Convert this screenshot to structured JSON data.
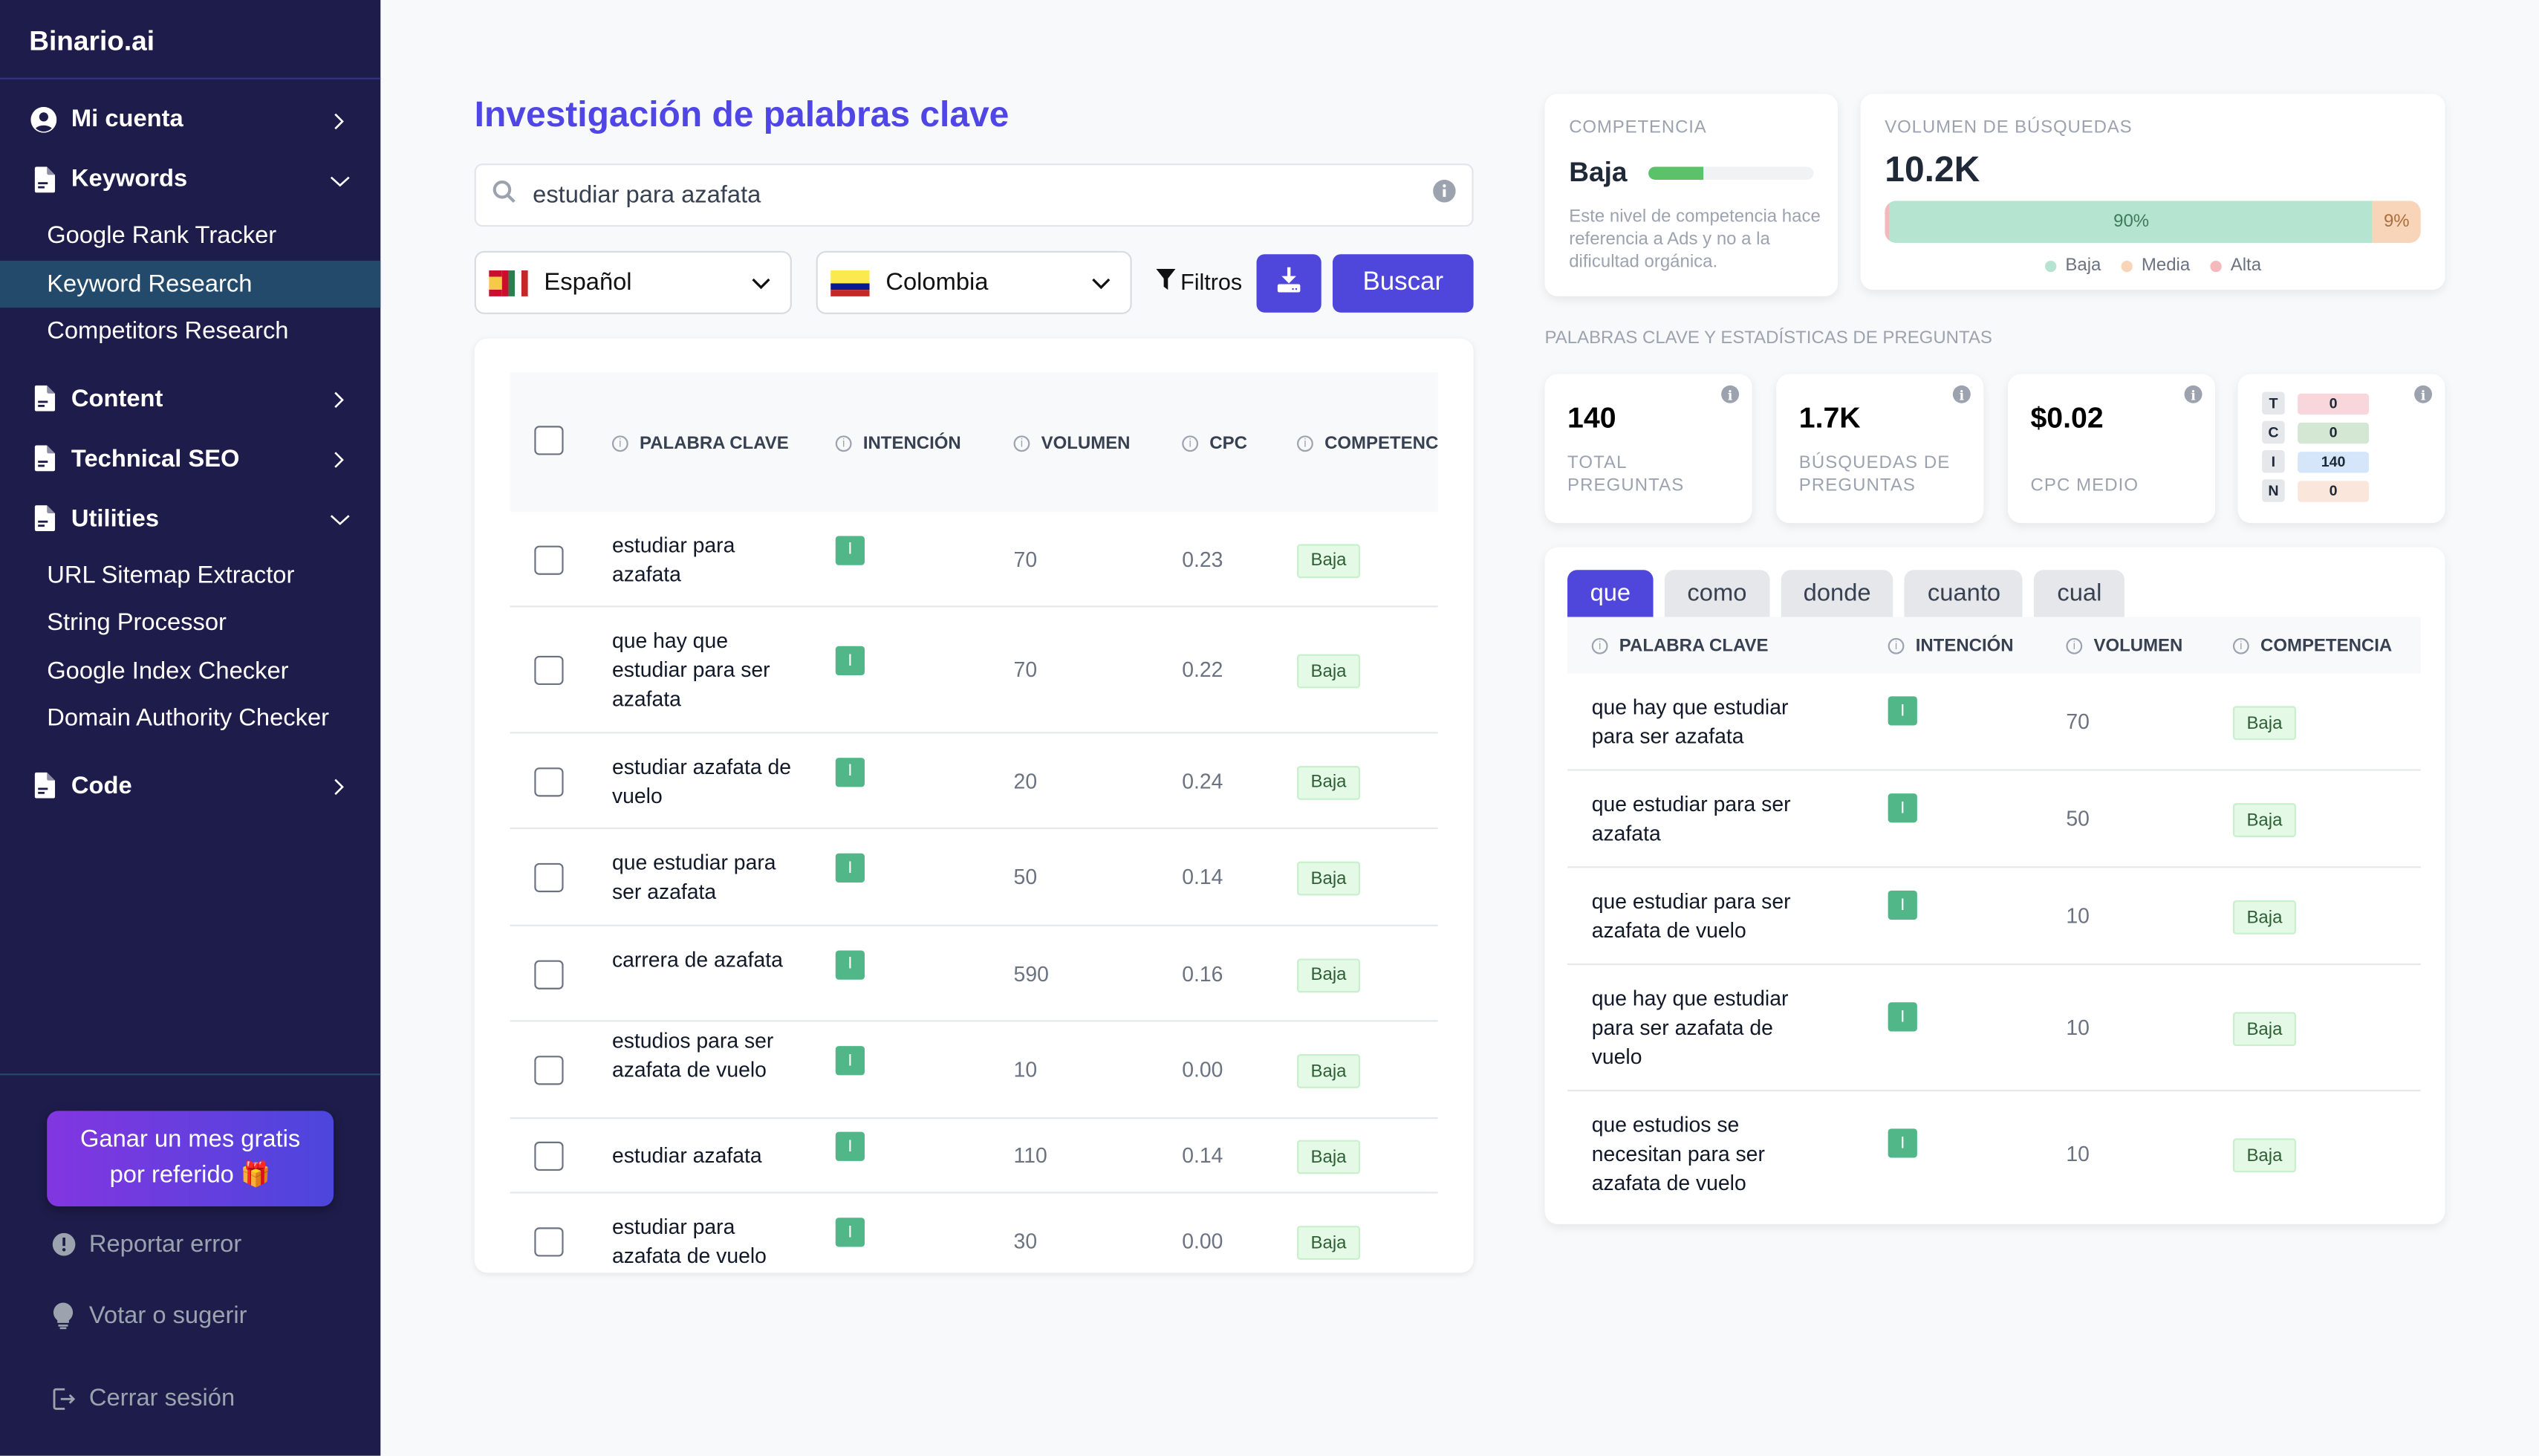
{
  "app": {
    "brand": "Binario.ai"
  },
  "sidebar": {
    "sections": [
      {
        "label": "Mi cuenta",
        "icon": "user-circle-icon",
        "expanded": false,
        "items": []
      },
      {
        "label": "Keywords",
        "icon": "document-icon",
        "expanded": true,
        "items": [
          {
            "label": "Google Rank Tracker",
            "active": false
          },
          {
            "label": "Keyword Research",
            "active": true
          },
          {
            "label": "Competitors Research",
            "active": false
          }
        ]
      },
      {
        "label": "Content",
        "icon": "document-icon",
        "expanded": false,
        "items": []
      },
      {
        "label": "Technical SEO",
        "icon": "document-icon",
        "expanded": false,
        "items": []
      },
      {
        "label": "Utilities",
        "icon": "document-icon",
        "expanded": true,
        "items": [
          {
            "label": "URL Sitemap Extractor"
          },
          {
            "label": "String Processor"
          },
          {
            "label": "Google Index Checker"
          },
          {
            "label": "Domain Authority Checker"
          }
        ]
      },
      {
        "label": "Code",
        "icon": "document-icon",
        "expanded": false,
        "items": []
      }
    ],
    "promo": {
      "line1": "Ganar un mes gratis",
      "line2": "por referido 🎁"
    },
    "links": {
      "report": "Reportar error",
      "vote": "Votar o sugerir",
      "logout": "Cerrar sesión"
    }
  },
  "main": {
    "title": "Investigación de palabras clave",
    "search": {
      "value": "estudiar para azafata",
      "placeholder": ""
    },
    "language": {
      "selected": "Español"
    },
    "country": {
      "selected": "Colombia"
    },
    "filters_label": "Filtros",
    "search_button": "Buscar",
    "table": {
      "columns": [
        "PALABRA CLAVE",
        "INTENCIÓN",
        "VOLUMEN",
        "CPC",
        "COMPETENC"
      ],
      "rows": [
        {
          "keyword": "estudiar para azafata",
          "intent": "I",
          "volume": "70",
          "cpc": "0.23",
          "competition": "Baja"
        },
        {
          "keyword": "que hay que estudiar para ser azafata",
          "intent": "I",
          "volume": "70",
          "cpc": "0.22",
          "competition": "Baja"
        },
        {
          "keyword": "estudiar azafata de vuelo",
          "intent": "I",
          "volume": "20",
          "cpc": "0.24",
          "competition": "Baja"
        },
        {
          "keyword": "que estudiar para ser azafata",
          "intent": "I",
          "volume": "50",
          "cpc": "0.14",
          "competition": "Baja"
        },
        {
          "keyword": "carrera de azafata",
          "intent": "I",
          "volume": "590",
          "cpc": "0.16",
          "competition": "Baja"
        },
        {
          "keyword": "estudios para ser azafata de vuelo",
          "intent": "I",
          "volume": "10",
          "cpc": "0.00",
          "competition": "Baja"
        },
        {
          "keyword": "estudiar azafata",
          "intent": "I",
          "volume": "110",
          "cpc": "0.14",
          "competition": "Baja"
        },
        {
          "keyword": "estudiar para azafata de vuelo",
          "intent": "I",
          "volume": "30",
          "cpc": "0.00",
          "competition": "Baja"
        }
      ]
    }
  },
  "right": {
    "competition": {
      "caption": "COMPETENCIA",
      "value": "Baja",
      "level_percent": 33,
      "description": "Este nivel de competencia hace referencia a Ads y no a la dificultad orgánica."
    },
    "volume": {
      "caption": "VOLUMEN DE BÚSQUEDAS",
      "value": "10.2K",
      "distribution": [
        {
          "name": "Alta",
          "percent": 1,
          "label": "",
          "color": "#f4b9bc"
        },
        {
          "name": "Baja",
          "percent": 90,
          "label": "90%",
          "color": "#b5e4d0"
        },
        {
          "name": "Media",
          "percent": 9,
          "label": "9%",
          "color": "#f8d4b8"
        }
      ],
      "legend": [
        {
          "name": "Baja",
          "color": "#b5e4d0"
        },
        {
          "name": "Media",
          "color": "#f8d4b8"
        },
        {
          "name": "Alta",
          "color": "#f4b9bc"
        }
      ]
    },
    "stats_caption": "PALABRAS CLAVE Y ESTADÍSTICAS DE PREGUNTAS",
    "stats": [
      {
        "value": "140",
        "label": "TOTAL PREGUNTAS"
      },
      {
        "value": "1.7K",
        "label": "BÚSQUEDAS DE PREGUNTAS"
      },
      {
        "value": "$0.02",
        "label": "CPC MEDIO"
      }
    ],
    "intent_counts": [
      {
        "key": "T",
        "value": "0",
        "color": "#f9d5dc"
      },
      {
        "key": "C",
        "value": "0",
        "color": "#d3e7d3"
      },
      {
        "key": "I",
        "value": "140",
        "color": "#d5e6fb"
      },
      {
        "key": "N",
        "value": "0",
        "color": "#fbe6dc"
      }
    ],
    "questions": {
      "tabs": [
        {
          "label": "que",
          "active": true
        },
        {
          "label": "como"
        },
        {
          "label": "donde"
        },
        {
          "label": "cuanto"
        },
        {
          "label": "cual"
        }
      ],
      "columns": [
        "PALABRA CLAVE",
        "INTENCIÓN",
        "VOLUMEN",
        "COMPETENCIA"
      ],
      "rows": [
        {
          "keyword": "que hay que estudiar para ser azafata",
          "intent": "I",
          "volume": "70",
          "competition": "Baja"
        },
        {
          "keyword": "que estudiar para ser azafata",
          "intent": "I",
          "volume": "50",
          "competition": "Baja"
        },
        {
          "keyword": "que estudiar para ser azafata de vuelo",
          "intent": "I",
          "volume": "10",
          "competition": "Baja"
        },
        {
          "keyword": "que hay que estudiar para ser azafata de vuelo",
          "intent": "I",
          "volume": "10",
          "competition": "Baja"
        },
        {
          "keyword": "que estudios se necesitan para ser azafata de vuelo",
          "intent": "I",
          "volume": "10",
          "competition": "Baja"
        }
      ]
    }
  }
}
